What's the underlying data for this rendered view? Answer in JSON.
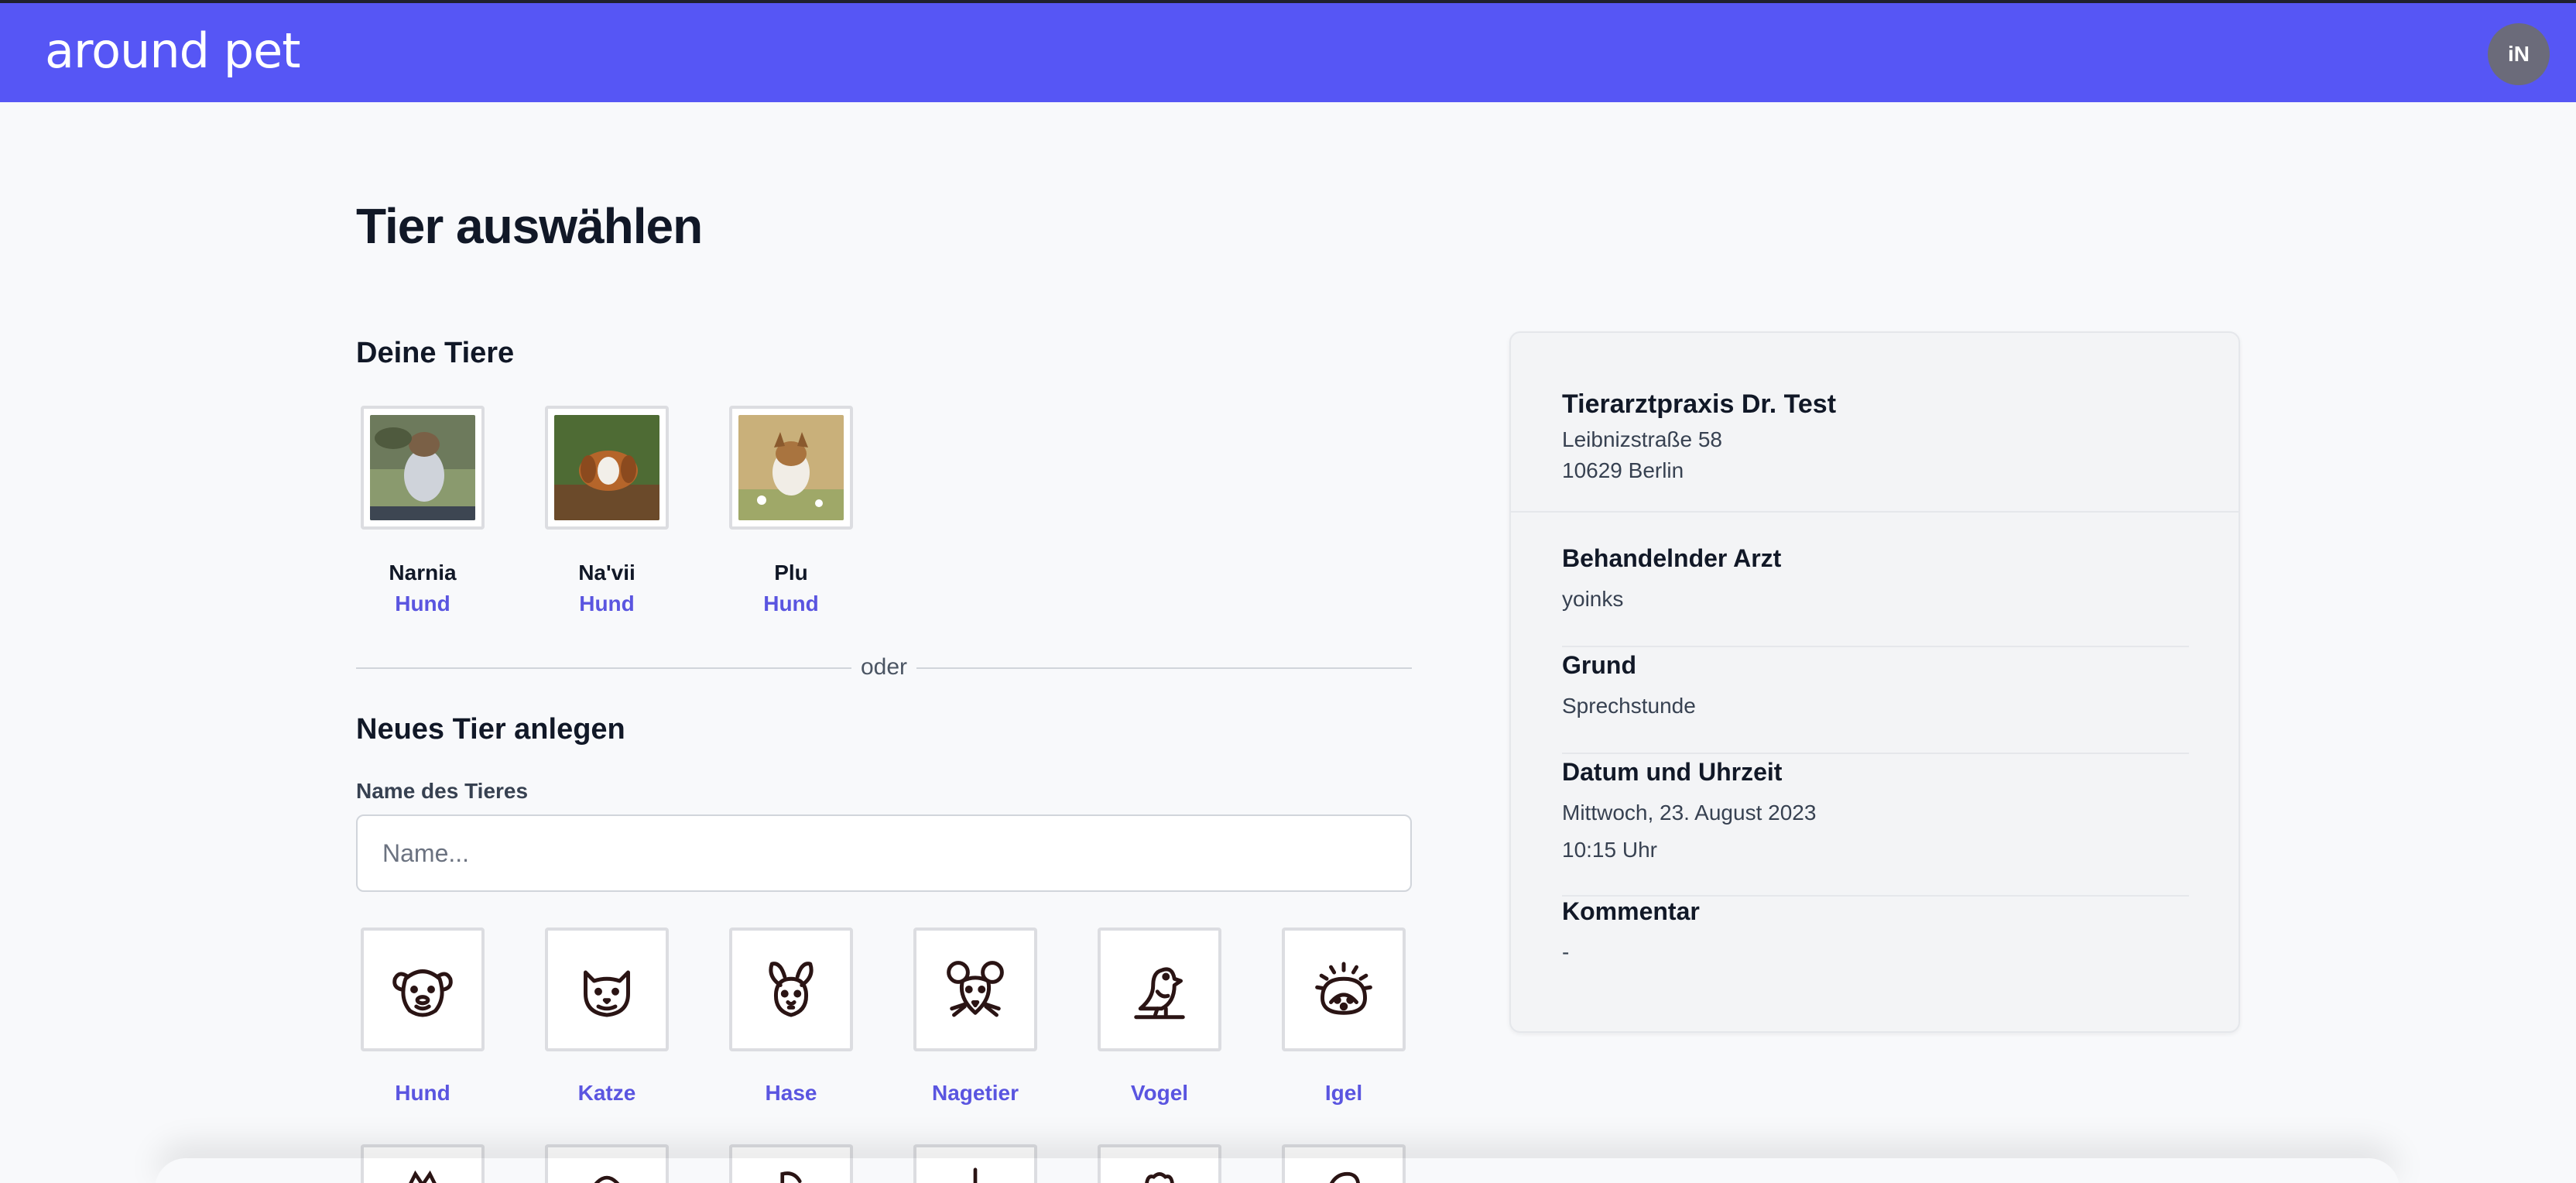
{
  "header": {
    "logo": "around pet",
    "avatar_initials": "iN",
    "bg_color": "#5656f5"
  },
  "page_title": "Tier auswählen",
  "your_pets": {
    "title": "Deine Tiere",
    "items": [
      {
        "name": "Narnia",
        "species": "Hund",
        "photo": "dog-photo"
      },
      {
        "name": "Na'vii",
        "species": "Hund",
        "photo": "dog-photo"
      },
      {
        "name": "Plu",
        "species": "Hund",
        "photo": "dog-photo"
      }
    ]
  },
  "divider_label": "oder",
  "new_pet": {
    "title": "Neues Tier anlegen",
    "name_label": "Name des Tieres",
    "name_placeholder": "Name...",
    "name_value": "",
    "species": [
      {
        "label": "Hund",
        "icon": "dog-icon"
      },
      {
        "label": "Katze",
        "icon": "cat-icon"
      },
      {
        "label": "Hase",
        "icon": "rabbit-icon"
      },
      {
        "label": "Nagetier",
        "icon": "rodent-icon"
      },
      {
        "label": "Vogel",
        "icon": "bird-icon"
      },
      {
        "label": "Igel",
        "icon": "hedgehog-icon"
      }
    ]
  },
  "appointment": {
    "practice_name": "Tierarztpraxis Dr. Test",
    "street": "Leibnizstraße 58",
    "city": "10629 Berlin",
    "doctor_label": "Behandelnder Arzt",
    "doctor_value": "yoinks",
    "reason_label": "Grund",
    "reason_value": "Sprechstunde",
    "datetime_label": "Datum und Uhrzeit",
    "date_value": "Mittwoch, 23. August 2023",
    "time_value": "10:15 Uhr",
    "comment_label": "Kommentar",
    "comment_value": "-"
  },
  "accent_color": "#5a55e0"
}
